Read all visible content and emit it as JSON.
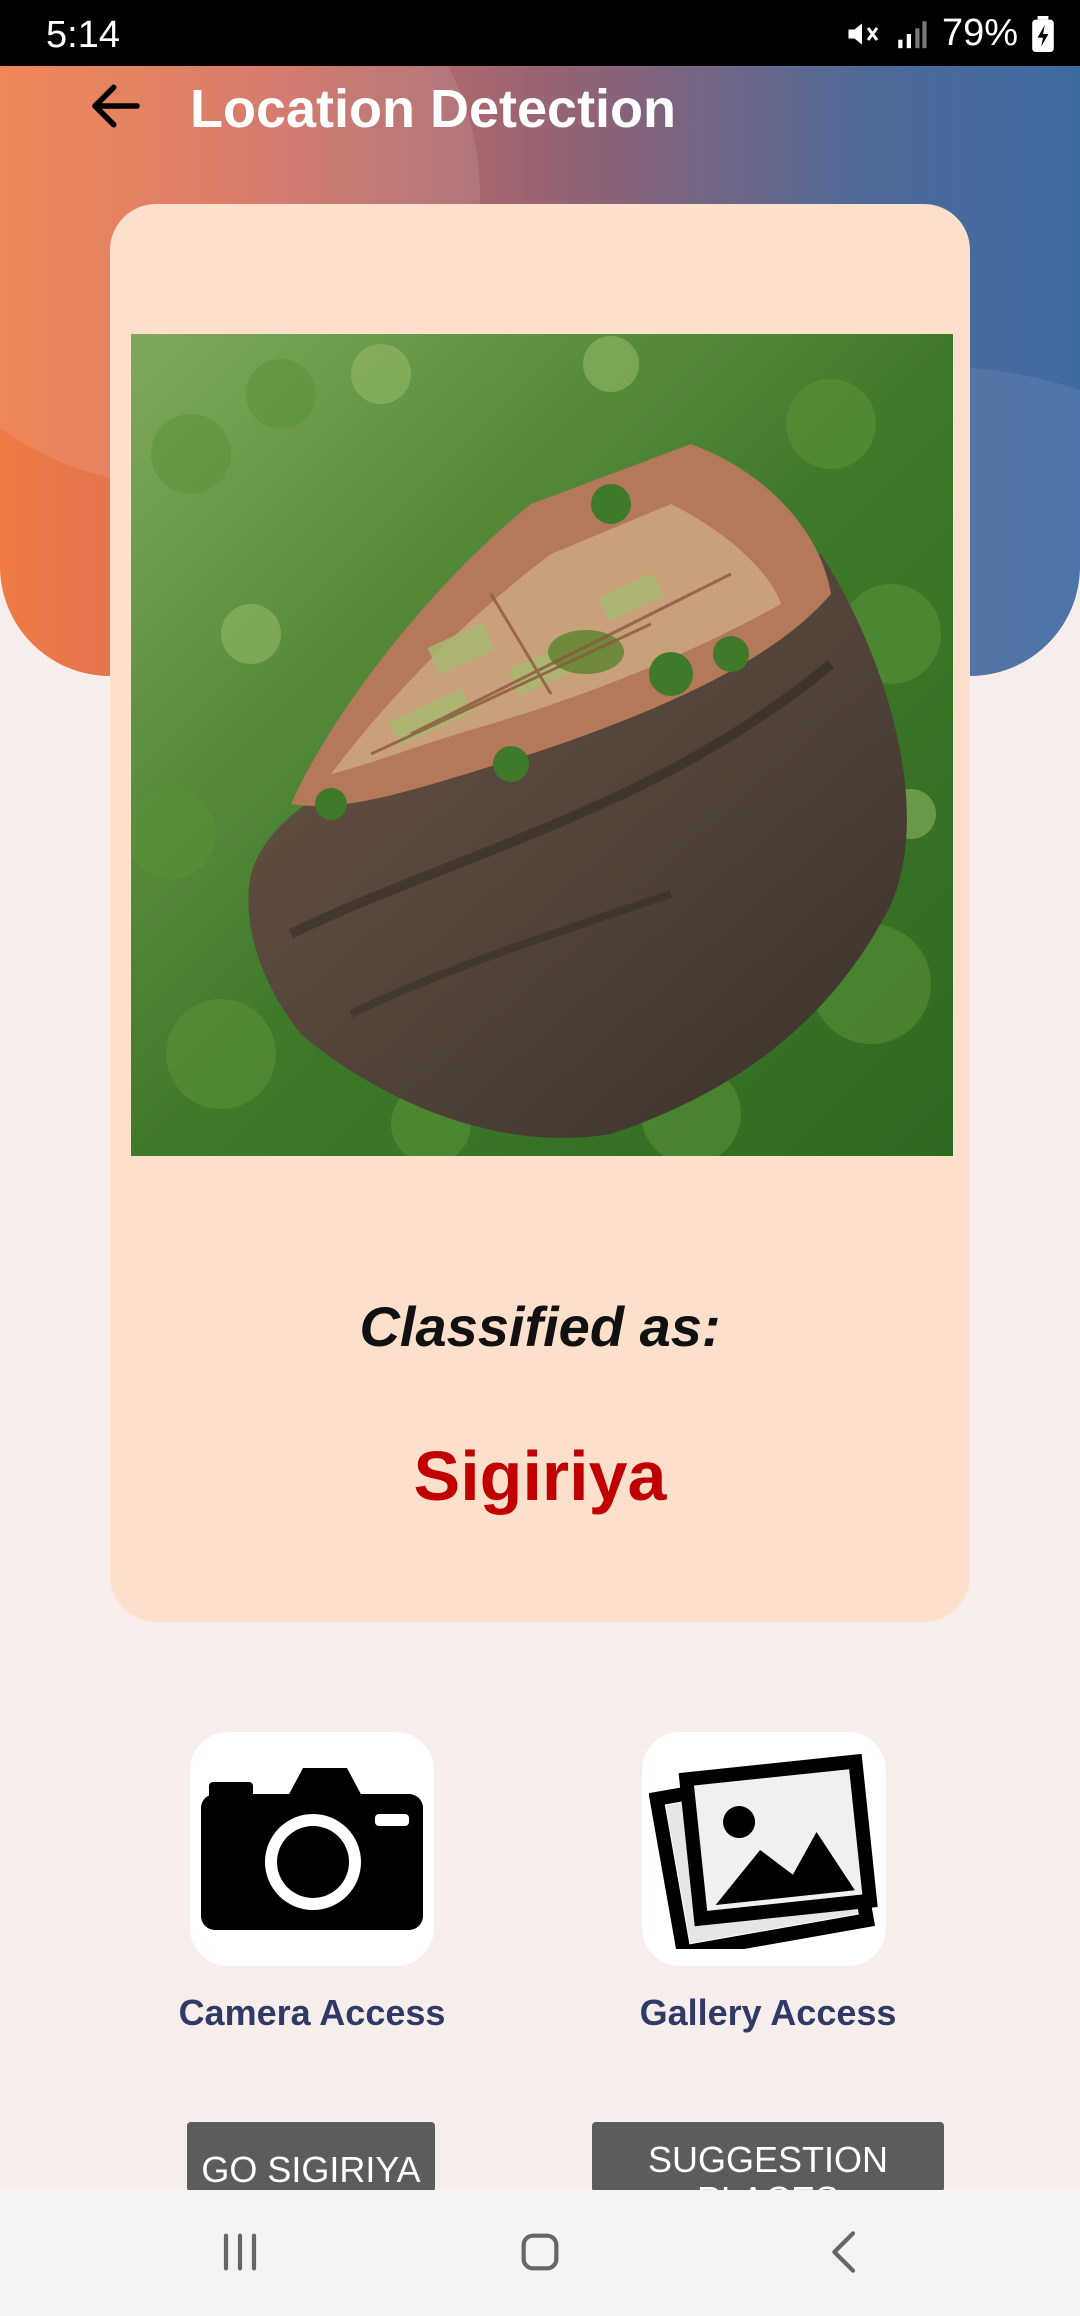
{
  "status_bar": {
    "time": "5:14",
    "battery": "79%"
  },
  "header": {
    "title": "Location Detection"
  },
  "result_card": {
    "classified_label": "Classified as:",
    "result": "Sigiriya"
  },
  "actions": {
    "camera_label": "Camera Access",
    "gallery_label": "Gallery Access"
  },
  "buttons": {
    "go_label": "GO SIGIRIYA",
    "suggestion_label": "SUGGESTION PLACES"
  },
  "colors": {
    "header_gradient_start": "#ef7a44",
    "header_gradient_end": "#3e6aa2",
    "card_background": "#fde0cc",
    "result_text": "#c00000",
    "action_label_text": "#2f3a66",
    "button_background": "#5c5c5c"
  }
}
